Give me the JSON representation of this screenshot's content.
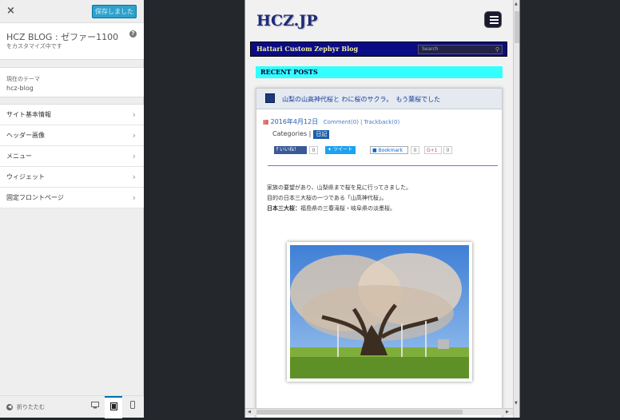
{
  "customizer": {
    "close_icon": "×",
    "saved_label": "保存しました",
    "title": "HCZ BLOG : ゼファー1100",
    "subtitle": "をカスタマイズ中です",
    "help_icon": "?",
    "theme_label": "現在のテーマ",
    "theme_name": "hcz-blog",
    "menu": [
      {
        "label": "サイト基本情報"
      },
      {
        "label": "ヘッダー画像"
      },
      {
        "label": "メニュー"
      },
      {
        "label": "ウィジェット"
      },
      {
        "label": "固定フロントページ"
      }
    ],
    "collapse_label": "折りたたむ",
    "devices": [
      "desktop-icon",
      "tablet-icon",
      "mobile-icon"
    ]
  },
  "preview": {
    "logo": "HCZ.JP",
    "nav_title": "Hattari Custom Zephyr Blog",
    "search_placeholder": "Search",
    "recent_heading": "RECENT POSTS",
    "post": {
      "title": "山梨の山高神代桜と わに桜のサクラ。　もう葉桜でした",
      "date": "2016年4月12日",
      "comments": "Comment(0)",
      "separator": "|",
      "trackbacks": "Trackback(0)",
      "categories_label": "Categories |",
      "category": "日記",
      "share": {
        "fb_label": "いいね！",
        "fb_count": "0",
        "tw_label": "ツイート",
        "hatena_label": "Bookmark",
        "hatena_count": "0",
        "gplus_label": "G+1",
        "gplus_count": "0"
      },
      "body_line1": "家族の要望があり、山梨県まで桜を見に行ってきました。",
      "body_line2": "目的の日本三大桜の一つである「山高神代桜」。",
      "body_line3_bold": "日本三大桜：",
      "body_line3": "福島県の三春滝桜・岐阜県の淡墨桜。"
    }
  },
  "colors": {
    "accent_blue": "#2ea2cc",
    "navbar": "#0b0b88",
    "recent_bg": "#33ffff"
  }
}
